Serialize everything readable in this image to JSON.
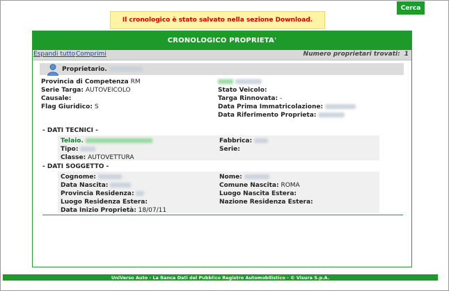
{
  "header": {
    "search_button": "Cerca"
  },
  "notice": "Il cronologico è stato salvato nella sezione Download.",
  "panel": {
    "title": "CRONOLOGICO PROPRIETA'",
    "expand_all": "Espandi tutto",
    "collapse": "Comprimi",
    "owners_found_label": "Numero proprietari trovati:",
    "owners_found_value": "1"
  },
  "owner": {
    "label": "Proprietario.",
    "left_fields": [
      {
        "label": "Provincia di Competenza",
        "value": "RM"
      },
      {
        "label": "Serie Targa:",
        "value": "AUTOVEICOLO"
      },
      {
        "label": "Causale:",
        "value": ""
      },
      {
        "label": "Flag Giuridico:",
        "value": "S"
      }
    ],
    "right_fields": [
      {
        "label": "Stato Veicolo:",
        "value": ""
      },
      {
        "label": "Targa Rinnovata:",
        "value": "-"
      },
      {
        "label": "Data Prima Immatricolazione:",
        "value": ""
      },
      {
        "label": "Data Riferimento Proprieta:",
        "value": ""
      }
    ]
  },
  "technical": {
    "section_title": "- DATI TECNICI -",
    "telaio_label": "Telaio.",
    "fabbrica_label": "Fabbrica:",
    "tipo_label": "Tipo:",
    "serie_label": "Serie:",
    "classe_label": "Classe:",
    "classe_value": "AUTOVETTURA"
  },
  "subject": {
    "section_title": "- DATI SOGGETTO -",
    "cognome_label": "Cognome:",
    "nome_label": "Nome:",
    "data_nascita_label": "Data Nascita:",
    "comune_nascita_label": "Comune Nascita:",
    "comune_nascita_value": "ROMA",
    "provincia_residenza_label": "Provincia Residenza:",
    "luogo_nascita_estera_label": "Luogo Nascita Estera:",
    "luogo_residenza_estera_label": "Luogo Residenza Estera:",
    "nazione_residenza_estera_label": "Nazione Residenza Estera:",
    "data_inizio_label": "Data Inizio Proprietà:",
    "data_inizio_value": "18/07/11"
  },
  "footer": "UniVerso Auto - La Banca Dati del Pubblico Registro Automobilistico - © Visura S.p.A.",
  "colors": {
    "accent": "#1e9a2a",
    "notice_bg": "#fff3a6",
    "notice_text": "#cc0000"
  }
}
